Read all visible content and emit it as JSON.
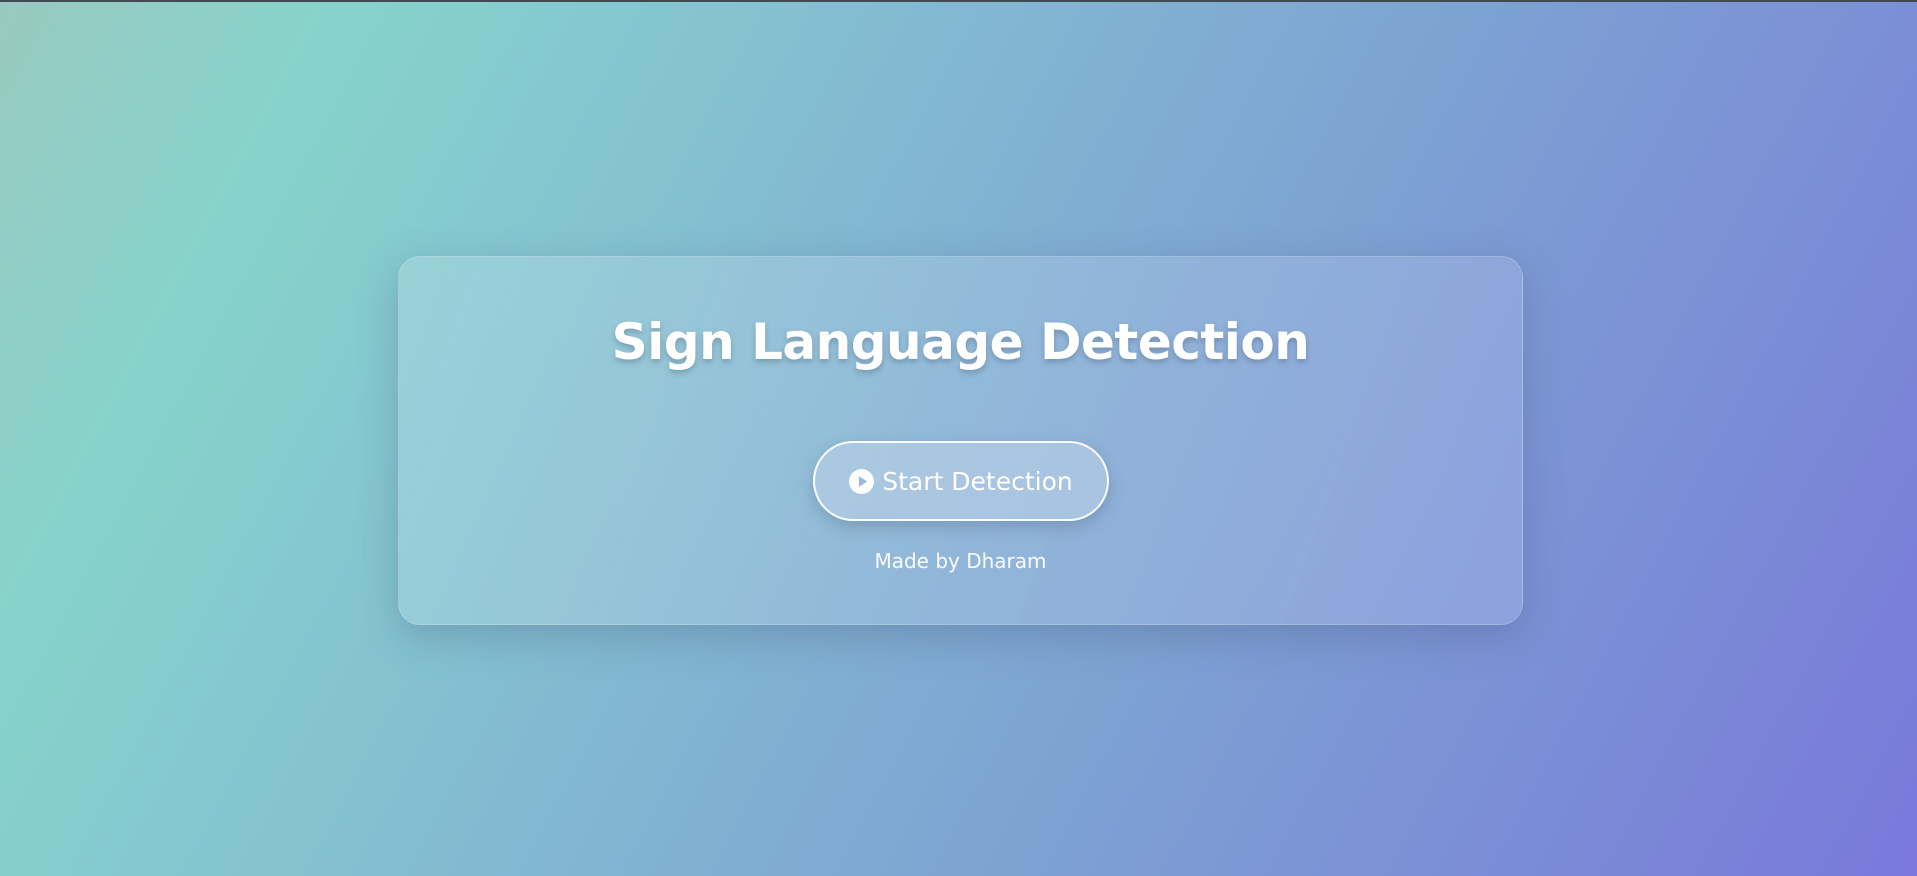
{
  "page": {
    "title": "Sign Language Detection",
    "start_button_label": "Start Detection",
    "start_button_icon": "play-circle-icon",
    "credit": "Made by Dharam"
  },
  "colors": {
    "background_start": "#98c9bf",
    "background_mid": "#81b0d2",
    "background_end": "#7a78da",
    "text": "#ffffff"
  }
}
